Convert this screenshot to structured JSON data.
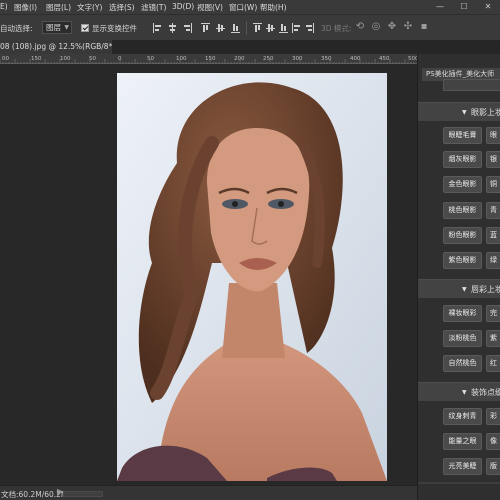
{
  "menubar": {
    "items": [
      "E)",
      "图像(I)",
      "图层(L)",
      "文字(Y)",
      "选择(S)",
      "滤镜(T)",
      "3D(D)",
      "视图(V)",
      "窗口(W)",
      "帮助(H)"
    ],
    "window_controls": [
      "—",
      "☐",
      "✕"
    ]
  },
  "options_bar": {
    "auto_select_label": "自动选择:",
    "auto_select_value": "图层",
    "show_transform_label": "显示变换控件",
    "show_transform_checked": true,
    "mode_3d_label": "3D 模式:"
  },
  "document": {
    "tab_title": "08 (108).jpg @ 12.5%(RGB/8*)",
    "tab_close": "×"
  },
  "ruler": {
    "labels": [
      "00",
      "150",
      "100",
      "50",
      "0",
      "50",
      "100",
      "150",
      "200",
      "250",
      "300",
      "350",
      "400",
      "450",
      "500"
    ]
  },
  "panel": {
    "title": "PS美化插件_美化大师",
    "sections": [
      {
        "title": "眼影上妆",
        "buttons": [
          [
            "眼睫毛膏",
            "眼"
          ],
          [
            "烟灰眼影",
            "银"
          ],
          [
            "金色眼影",
            "铜"
          ],
          [
            "桃色眼影",
            "青"
          ],
          [
            "粉色眼影",
            "蓝"
          ],
          [
            "紫色眼影",
            "绿"
          ]
        ]
      },
      {
        "title": "唇彩上妆",
        "buttons": [
          [
            "裸妆眼彩",
            "完"
          ],
          [
            "淡粉桃色",
            "紫"
          ],
          [
            "自然桃色",
            "红"
          ]
        ]
      },
      {
        "title": "装饰点缀",
        "buttons": [
          [
            "纹身刺青",
            "彩"
          ],
          [
            "能量之眼",
            "像"
          ],
          [
            "光亮美睫",
            "版"
          ]
        ]
      }
    ]
  },
  "status": {
    "text": "文档:60.2M/60.2M",
    "arrow": "▶"
  }
}
